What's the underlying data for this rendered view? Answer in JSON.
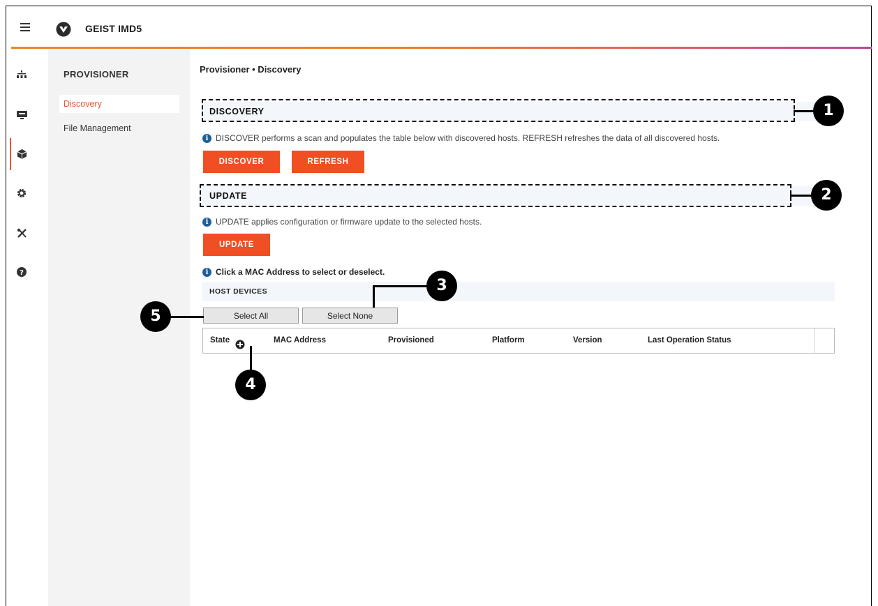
{
  "app": {
    "title": "GEIST IMD5"
  },
  "rail": {
    "icons": [
      "network-tree-icon",
      "monitor-icon",
      "cube-icon",
      "gear-icon",
      "tools-icon",
      "help-icon"
    ]
  },
  "sidebar": {
    "title": "PROVISIONER",
    "items": [
      {
        "label": "Discovery",
        "active": true
      },
      {
        "label": "File Management",
        "active": false
      }
    ]
  },
  "main": {
    "breadcrumb": "Provisioner • Discovery",
    "discovery": {
      "heading": "DISCOVERY",
      "info": "DISCOVER performs a scan and populates the table below with discovered hosts. REFRESH refreshes the data of all discovered hosts.",
      "discover_label": "DISCOVER",
      "refresh_label": "REFRESH"
    },
    "update": {
      "heading": "UPDATE",
      "info": "UPDATE applies configuration or firmware update to the selected hosts.",
      "update_label": "UPDATE"
    },
    "mac_note": "Click a MAC Address to select or deselect.",
    "host_devices": {
      "heading": "HOST DEVICES",
      "select_all_label": "Select All",
      "select_none_label": "Select None",
      "columns": [
        "State",
        "+",
        "MAC Address",
        "Provisioned",
        "Platform",
        "Version",
        "Last Operation Status"
      ]
    }
  },
  "callouts": [
    "1",
    "2",
    "3",
    "4",
    "5"
  ],
  "colors": {
    "accent": "#f04e23",
    "info": "#1f5e99",
    "header_bg": "#f3f7fb"
  }
}
